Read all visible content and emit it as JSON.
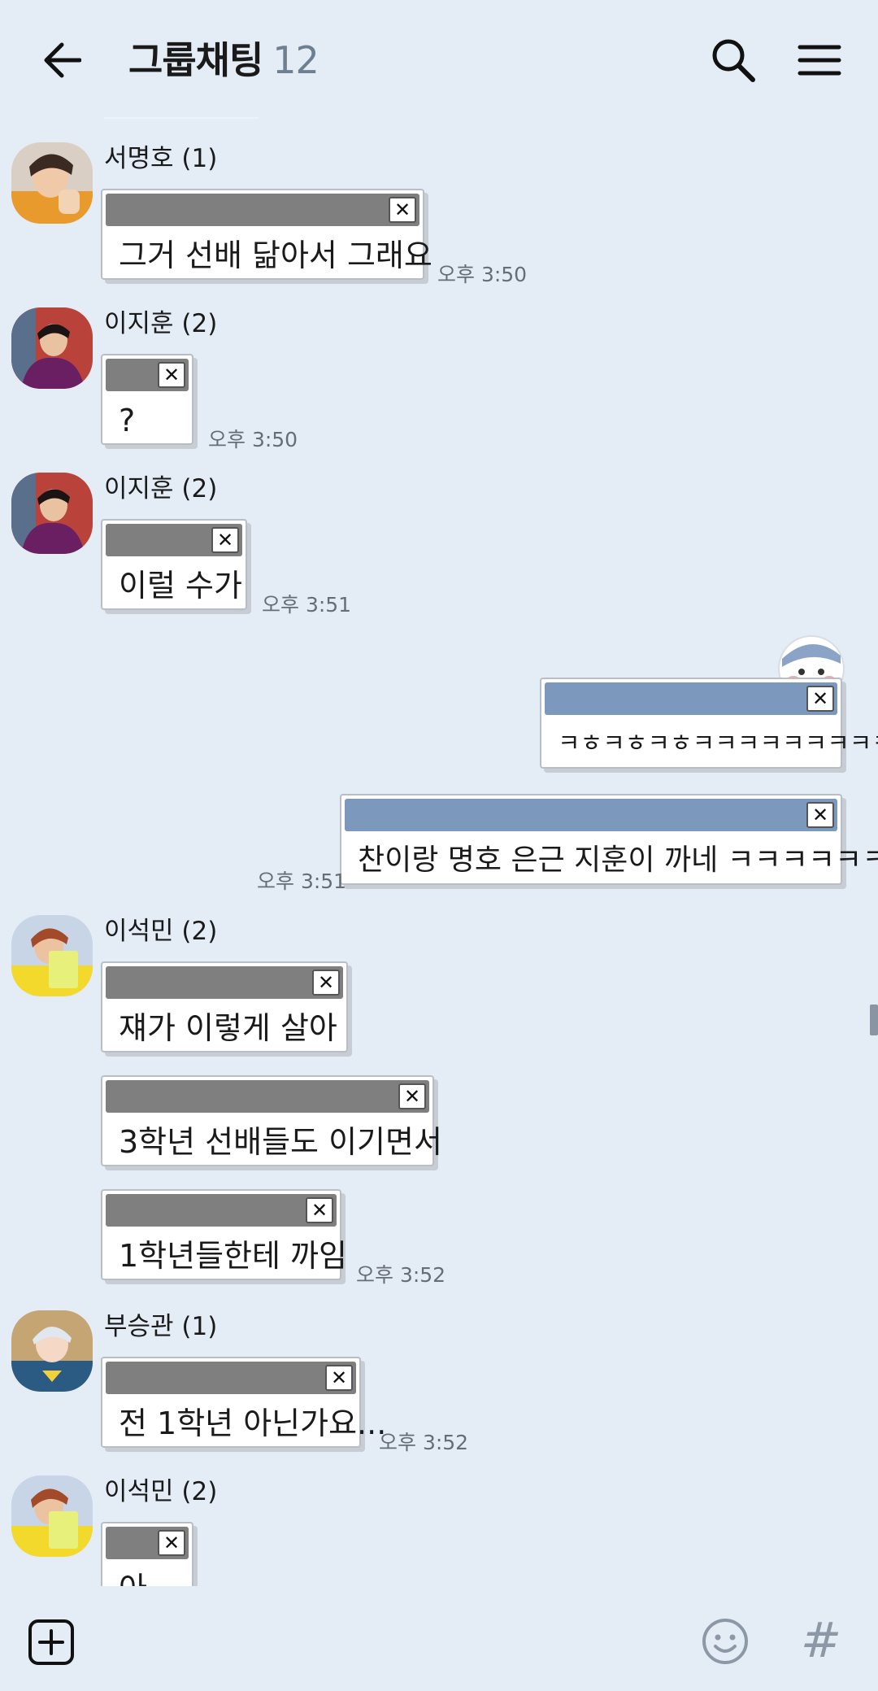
{
  "header": {
    "title": "그룹채팅",
    "member_count": "12"
  },
  "messages": [
    {
      "sender": "서명호 (1)",
      "text": "그거 선배 닮아서 그래요",
      "time": "오후 3:50"
    },
    {
      "sender": "이지훈 (2)",
      "text": "?",
      "time": "오후 3:50"
    },
    {
      "sender": "이지훈 (2)",
      "text": "이럴 수가",
      "time": "오후 3:51"
    },
    {
      "mine": true,
      "text": "ㅋㅎㅋㅎㅋㅎㅋㅋㅋㅋㅋㅋㅋㅋㅋ"
    },
    {
      "mine": true,
      "text": "찬이랑 명호 은근 지훈이 까네 ㅋㅋㅋㅋㅋㅋ",
      "time": "오후 3:51"
    },
    {
      "sender": "이석민 (2)",
      "text": "쟤가 이렇게 살아"
    },
    {
      "text": "3학년 선배들도 이기면서"
    },
    {
      "text": "1학년들한테 까임",
      "time": "오후 3:52"
    },
    {
      "sender": "부승관 (1)",
      "text": "전 1학년 아닌가요...",
      "time": "오후 3:52"
    },
    {
      "sender": "이석민 (2)",
      "text": "아"
    }
  ],
  "close_glyph": "✕",
  "bottom": {
    "hash_label": "#"
  },
  "colors": {
    "background": "#e4ecf6",
    "other_titlebar": "#7f7f7f",
    "mine_titlebar": "#7d98bd",
    "time_text": "#666d75"
  }
}
